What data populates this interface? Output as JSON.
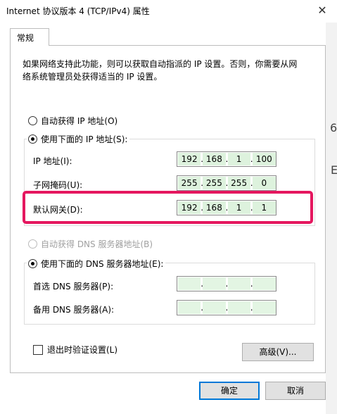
{
  "window": {
    "title": "Internet 协议版本 4 (TCP/IPv4) 属性",
    "close_glyph": "✕"
  },
  "tab": {
    "label": "常规"
  },
  "description": {
    "line1": "如果网络支持此功能，则可以获取自动指派的 IP 设置。否则，你需要从网",
    "line2": "络系统管理员处获得适当的 IP 设置。"
  },
  "ip_mode": {
    "auto_label": "自动获得 IP 地址(O)",
    "manual_label": "使用下面的 IP 地址(S):",
    "selected": "manual",
    "fields": {
      "ip": {
        "label": "IP 地址(I):",
        "octets": [
          "192",
          "168",
          "1",
          "100"
        ]
      },
      "mask": {
        "label": "子网掩码(U):",
        "octets": [
          "255",
          "255",
          "255",
          "0"
        ]
      },
      "gateway": {
        "label": "默认网关(D):",
        "octets": [
          "192",
          "168",
          "1",
          "1"
        ]
      }
    }
  },
  "dns_mode": {
    "auto_label": "自动获得 DNS 服务器地址(B)",
    "manual_label": "使用下面的 DNS 服务器地址(E):",
    "selected": "manual",
    "fields": {
      "preferred": {
        "label": "首选 DNS 服务器(P):",
        "octets": [
          "",
          "",
          "",
          ""
        ]
      },
      "alternate": {
        "label": "备用 DNS 服务器(A):",
        "octets": [
          "",
          "",
          "",
          ""
        ]
      }
    }
  },
  "validate_on_exit": {
    "label": "退出时验证设置(L)",
    "checked": false
  },
  "buttons": {
    "advanced": "高级(V)...",
    "ok": "确定",
    "cancel": "取消"
  },
  "background_fragments": [
    "6",
    "E"
  ],
  "colors": {
    "highlight": "#e5175f",
    "octet_fill": "#ddf2dd",
    "default_button_border": "#0078d7"
  }
}
